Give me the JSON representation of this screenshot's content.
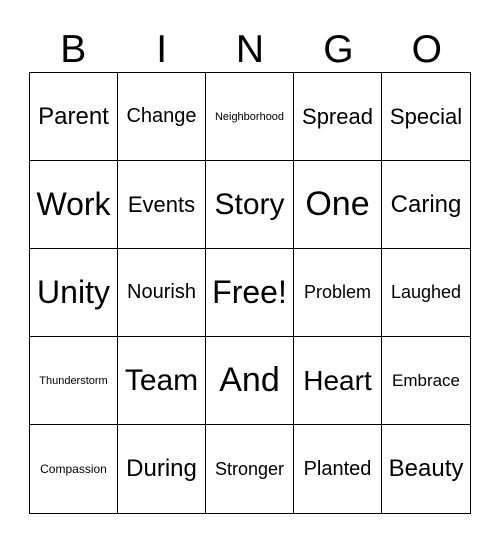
{
  "header": [
    "B",
    "I",
    "N",
    "G",
    "O"
  ],
  "cells": [
    [
      "Parent",
      "Change",
      "Neighborhood",
      "Spread",
      "Special"
    ],
    [
      "Work",
      "Events",
      "Story",
      "One",
      "Caring"
    ],
    [
      "Unity",
      "Nourish",
      "Free!",
      "Problem",
      "Laughed"
    ],
    [
      "Thunderstorm",
      "Team",
      "And",
      "Heart",
      "Embrace"
    ],
    [
      "Compassion",
      "During",
      "Stronger",
      "Planted",
      "Beauty"
    ]
  ]
}
